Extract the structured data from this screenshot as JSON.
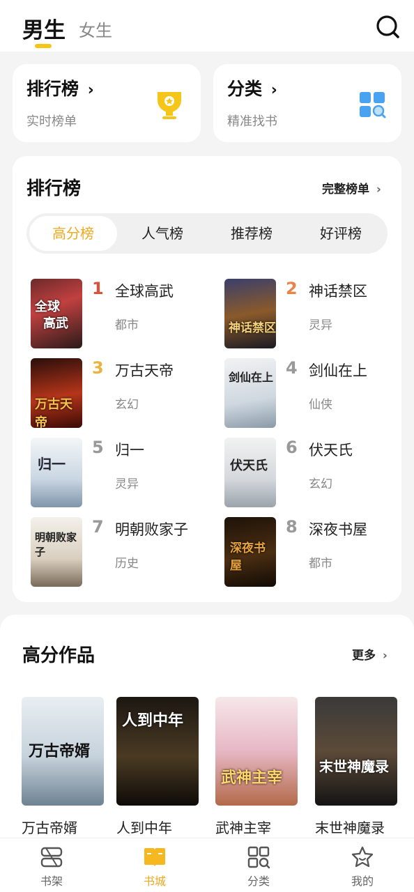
{
  "header": {
    "tabs": [
      {
        "label": "男生",
        "active": true
      },
      {
        "label": "女生",
        "active": false
      }
    ],
    "search_icon": "search-icon"
  },
  "quick_cards": [
    {
      "title": "排行榜",
      "subtitle": "实时榜单",
      "icon": "trophy-icon",
      "color": "#f5c518"
    },
    {
      "title": "分类",
      "subtitle": "精准找书",
      "icon": "grid-search-icon",
      "color": "#4aa3f0"
    }
  ],
  "ranking": {
    "title": "排行榜",
    "more_label": "完整榜单",
    "tabs": [
      "高分榜",
      "人气榜",
      "推荐榜",
      "好评榜"
    ],
    "active_tab": 0,
    "items": [
      {
        "rank": "1",
        "title": "全球高武",
        "category": "都市",
        "rank_color": "#d9533b"
      },
      {
        "rank": "2",
        "title": "神话禁区",
        "category": "灵异",
        "rank_color": "#e8844a"
      },
      {
        "rank": "3",
        "title": "万古天帝",
        "category": "玄幻",
        "rank_color": "#e8b340"
      },
      {
        "rank": "4",
        "title": "剑仙在上",
        "category": "仙侠",
        "rank_color": "#999999"
      },
      {
        "rank": "5",
        "title": "归一",
        "category": "灵异",
        "rank_color": "#999999"
      },
      {
        "rank": "6",
        "title": "伏天氏",
        "category": "玄幻",
        "rank_color": "#999999"
      },
      {
        "rank": "7",
        "title": "明朝败家子",
        "category": "历史",
        "rank_color": "#999999"
      },
      {
        "rank": "8",
        "title": "深夜书屋",
        "category": "都市",
        "rank_color": "#999999"
      }
    ]
  },
  "high_score": {
    "title": "高分作品",
    "more_label": "更多",
    "books": [
      {
        "title": "万古帝婿"
      },
      {
        "title": "人到中年"
      },
      {
        "title": "武神主宰"
      },
      {
        "title": "末世神魔录"
      }
    ]
  },
  "bottom_nav": [
    {
      "label": "书架",
      "icon": "bookshelf-icon",
      "active": false
    },
    {
      "label": "书城",
      "icon": "book-store-icon",
      "active": true
    },
    {
      "label": "分类",
      "icon": "category-grid-icon",
      "active": false
    },
    {
      "label": "我的",
      "icon": "profile-star-icon",
      "active": false
    }
  ],
  "colors": {
    "accent": "#f0a81c",
    "underline": "#f5c518"
  }
}
